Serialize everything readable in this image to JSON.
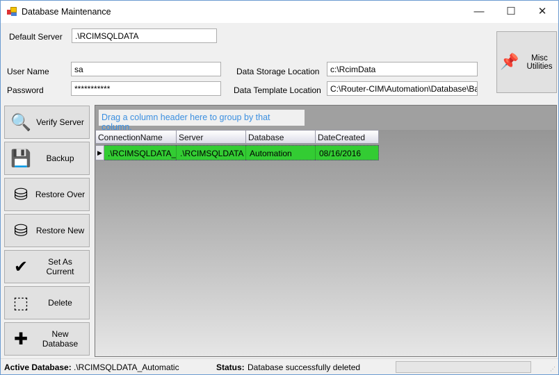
{
  "window": {
    "title": "Database Maintenance",
    "minimize": "—",
    "maximize": "☐",
    "close": "✕"
  },
  "form": {
    "default_server_label": "Default Server",
    "default_server_value": ".\\RCIMSQLDATA",
    "user_name_label": "User Name",
    "user_name_value": "sa",
    "password_label": "Password",
    "password_value": "***********",
    "data_storage_label": "Data Storage Location",
    "data_storage_value": "c:\\RcimData",
    "data_template_label": "Data Template Location",
    "data_template_value": "C:\\Router-CIM\\Automation\\Database\\Ba"
  },
  "misc_button": {
    "label_line1": "Misc",
    "label_line2": "Utilities",
    "icon": "pushpins-icon"
  },
  "side_buttons": [
    {
      "label": "Verify Server",
      "icon": "magnifier-icon",
      "glyph": "🔍"
    },
    {
      "label": "Backup",
      "icon": "floppy-disk-icon",
      "glyph": "💾"
    },
    {
      "label": "Restore Over",
      "icon": "restore-icon",
      "glyph": "⛁"
    },
    {
      "label": "Restore New",
      "icon": "restore-new-icon",
      "glyph": "⛁"
    },
    {
      "label": "Set As Current",
      "icon": "checkmark-icon",
      "glyph": "✔"
    },
    {
      "label": "Delete",
      "icon": "delete-selection-icon",
      "glyph": "⬚"
    },
    {
      "label": "New Database",
      "icon": "plus-icon",
      "glyph": "✚"
    }
  ],
  "grid": {
    "group_hint": "Drag a column header here to group by that column.",
    "columns": [
      "ConnectionName",
      "Server",
      "Database",
      "DateCreated"
    ],
    "rows": [
      [
        ".\\RCIMSQLDATA_",
        ".\\RCIMSQLDATA",
        "Automation",
        "08/16/2016"
      ]
    ],
    "selected_row_color": "#33cc33"
  },
  "status_bar": {
    "active_db_label": "Active Database:",
    "active_db_value": ".\\RCIMSQLDATA_Automatic",
    "status_label": "Status:",
    "status_value": "Database successfully deleted"
  }
}
